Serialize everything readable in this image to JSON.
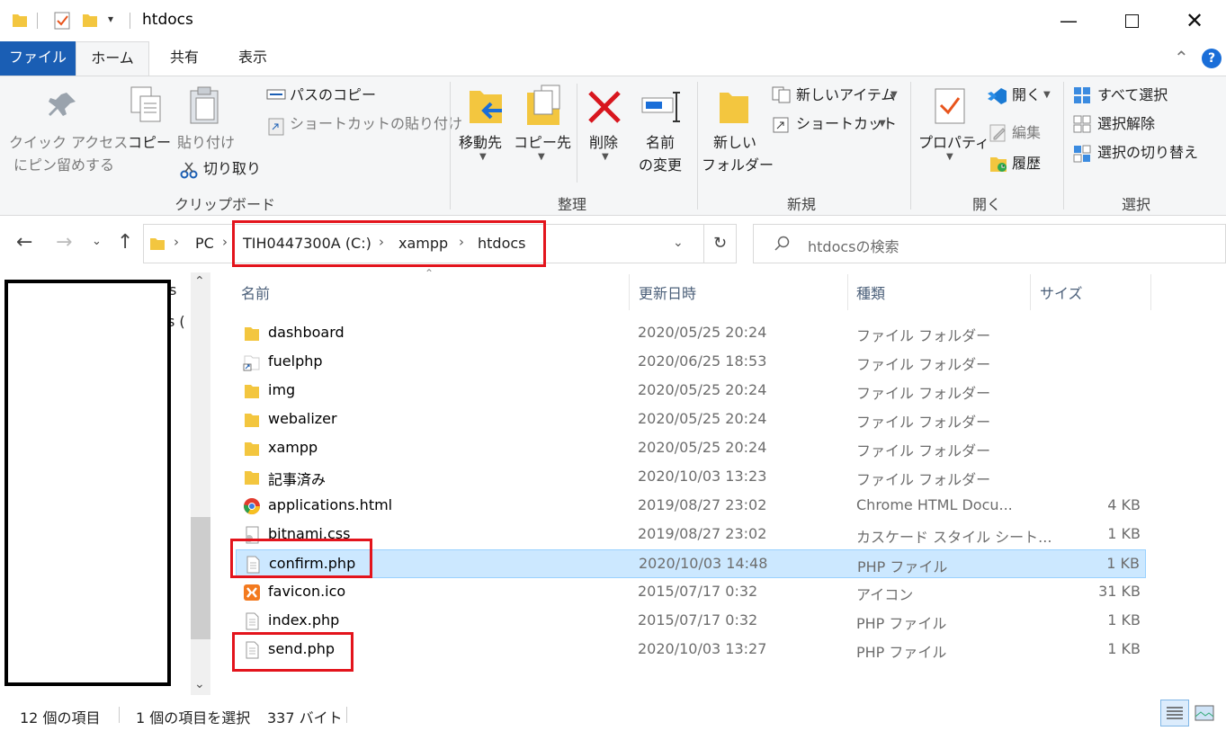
{
  "window": {
    "title": "htdocs"
  },
  "tabs": {
    "file": "ファイル",
    "home": "ホーム",
    "share": "共有",
    "view": "表示"
  },
  "ribbon": {
    "pin_line1": "クイック アクセス",
    "pin_line2": "にピン留めする",
    "copy": "コピー",
    "paste": "貼り付け",
    "copy_path": "パスのコピー",
    "paste_shortcut": "ショートカットの貼り付け",
    "cut": "切り取り",
    "group_clipboard": "クリップボード",
    "move_to": "移動先",
    "copy_to": "コピー先",
    "delete": "削除",
    "rename_line1": "名前",
    "rename_line2": "の変更",
    "group_organize": "整理",
    "new_folder_line1": "新しい",
    "new_folder_line2": "フォルダー",
    "new_item": "新しいアイテム",
    "shortcut": "ショートカット",
    "group_new": "新規",
    "properties": "プロパティ",
    "open": "開く",
    "edit": "編集",
    "history": "履歴",
    "group_open": "開く",
    "select_all": "すべて選択",
    "select_none": "選択解除",
    "invert_selection": "選択の切り替え",
    "group_select": "選択"
  },
  "address": {
    "crumbs": [
      "PC",
      "TIH0447300A (C:)",
      "xampp",
      "htdocs"
    ],
    "search_placeholder": "htdocsの検索"
  },
  "leftpane": {
    "partial1": "s",
    "partial2": "s ("
  },
  "columns": {
    "name": "名前",
    "date": "更新日時",
    "type": "種類",
    "size": "サイズ"
  },
  "files": [
    {
      "name": "dashboard",
      "date": "2020/05/25 20:24",
      "type": "ファイル フォルダー",
      "size": "",
      "icon": "folder-icon"
    },
    {
      "name": "fuelphp",
      "date": "2020/06/25 18:53",
      "type": "ファイル フォルダー",
      "size": "",
      "icon": "folder-shortcut-icon"
    },
    {
      "name": "img",
      "date": "2020/05/25 20:24",
      "type": "ファイル フォルダー",
      "size": "",
      "icon": "folder-icon"
    },
    {
      "name": "webalizer",
      "date": "2020/05/25 20:24",
      "type": "ファイル フォルダー",
      "size": "",
      "icon": "folder-icon"
    },
    {
      "name": "xampp",
      "date": "2020/05/25 20:24",
      "type": "ファイル フォルダー",
      "size": "",
      "icon": "folder-icon"
    },
    {
      "name": "記事済み",
      "date": "2020/10/03 13:23",
      "type": "ファイル フォルダー",
      "size": "",
      "icon": "folder-icon"
    },
    {
      "name": "applications.html",
      "date": "2019/08/27 23:02",
      "type": "Chrome HTML Docu...",
      "size": "4 KB",
      "icon": "chrome-icon"
    },
    {
      "name": "bitnami.css",
      "date": "2019/08/27 23:02",
      "type": "カスケード スタイル シート...",
      "size": "1 KB",
      "icon": "css-file-icon"
    },
    {
      "name": "confirm.php",
      "date": "2020/10/03 14:48",
      "type": "PHP ファイル",
      "size": "1 KB",
      "icon": "document-icon",
      "selected": true
    },
    {
      "name": "favicon.ico",
      "date": "2015/07/17 0:32",
      "type": "アイコン",
      "size": "31 KB",
      "icon": "xampp-icon"
    },
    {
      "name": "index.php",
      "date": "2015/07/17 0:32",
      "type": "PHP ファイル",
      "size": "1 KB",
      "icon": "document-icon"
    },
    {
      "name": "send.php",
      "date": "2020/10/03 13:27",
      "type": "PHP ファイル",
      "size": "1 KB",
      "icon": "document-icon"
    }
  ],
  "status": {
    "count": "12 個の項目",
    "selection": "1 個の項目を選択",
    "bytes": "337 バイト"
  },
  "colors": {
    "accent": "#1a5eb4",
    "selection": "#cce8ff",
    "highlight_box": "#e3141c",
    "folder": "#f3c63f"
  }
}
